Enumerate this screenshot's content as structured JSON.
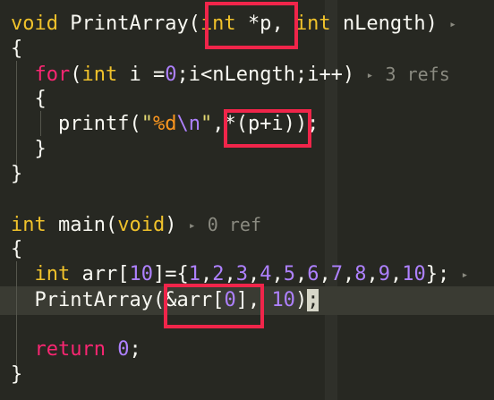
{
  "colors": {
    "background": "#272822",
    "keyword_type": "#f0c22b",
    "keyword_control": "#f92672",
    "number": "#ae81ff",
    "string": "#e6db74",
    "format_specifier": "#fd971f",
    "highlight_box": "#f0254a",
    "codelens": "#8a8a80"
  },
  "code": {
    "line1": {
      "kw_void": "void",
      "fn_name": "PrintArray(",
      "kw_int1": "int",
      "param1": "*p",
      "comma": ", ",
      "kw_int2": "int",
      "param2": "nLength)",
      "arrow": "▸"
    },
    "line2": {
      "text": "{"
    },
    "line3": {
      "kw_for": "for",
      "paren_open": "(",
      "kw_int": "int",
      "init": "i =",
      "zero": "0",
      "rest": ";i<nLength;i++)",
      "arrow": "▸",
      "refs": "3 refs"
    },
    "line4": {
      "text": "{"
    },
    "line5": {
      "call": "printf(",
      "quote_open": "\"",
      "fmt": "%d",
      "esc": "\\n",
      "quote_close": "\"",
      "comma": ",",
      "expr": "*(p+i)",
      "end": ");"
    },
    "line6": {
      "text": "}"
    },
    "line7": {
      "text": "}"
    },
    "line9": {
      "kw_int": "int",
      "fn_name": "main(",
      "kw_void": "void",
      "paren_close": ")",
      "arrow": "▸",
      "refs": "0 ref"
    },
    "line10": {
      "text": "{"
    },
    "line11": {
      "kw_int": "int",
      "decl": "arr[",
      "size": "10",
      "assign": "]={",
      "v1": "1",
      "v2": "2",
      "v3": "3",
      "v4": "4",
      "v5": "5",
      "v6": "6",
      "v7": "7",
      "v8": "8",
      "v9": "9",
      "v10": "10",
      "sep": ",",
      "end": "};",
      "arrow": "▸"
    },
    "line12": {
      "call": "PrintArray(",
      "arg1_a": "&arr[",
      "arg1_idx": "0",
      "arg1_b": "]",
      "comma": ", ",
      "arg2": "10",
      "close": ")",
      "semi": ";"
    },
    "line14": {
      "kw_return": "return",
      "space": " ",
      "zero": "0",
      "semi": ";"
    },
    "line15": {
      "text": "}"
    }
  }
}
